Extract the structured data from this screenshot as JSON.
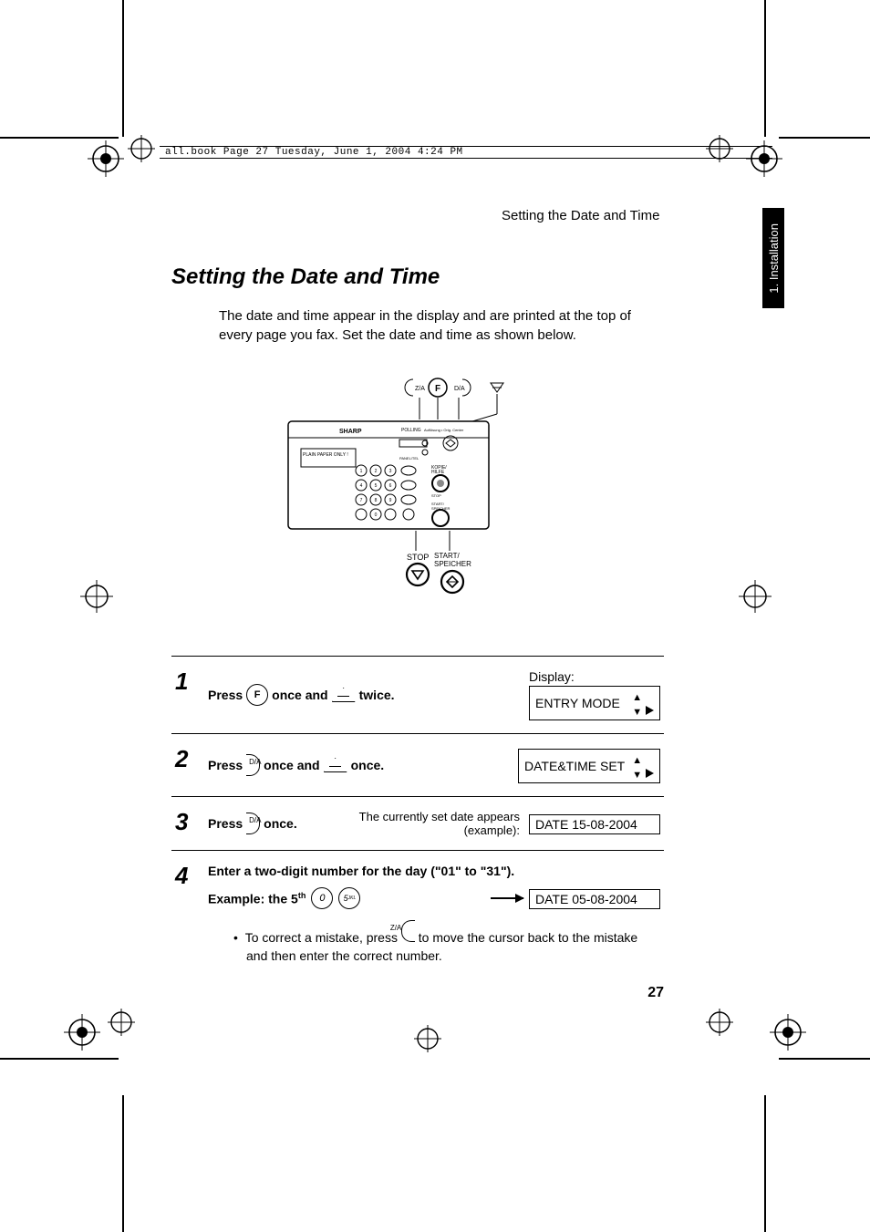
{
  "header_strip": "all.book  Page 27  Tuesday, June 1, 2004  4:24 PM",
  "running_head": "Setting the Date and Time",
  "side_tab": "1. Installation",
  "title": "Setting the Date and Time",
  "intro": "The date and time appear in the display and are printed at the top of every page you fax. Set the date and time as shown below.",
  "fax_labels": {
    "top_keys": [
      "Z/A",
      "F",
      "D/A"
    ],
    "brand": "SHARP",
    "below": [
      "STOP",
      "START/\nSPEICHER",
      "KOPIE/HILFE"
    ]
  },
  "display_label": "Display:",
  "steps": [
    {
      "n": "1",
      "parts": [
        "Press ",
        {
          "key": "oval",
          "t": "F"
        },
        " once and ",
        {
          "key": "tri"
        },
        " twice."
      ],
      "lcd": "ENTRY MODE",
      "lcd_arrows": true
    },
    {
      "n": "2",
      "parts": [
        "Press ",
        {
          "key": "half",
          "t": "D/A"
        },
        " once and ",
        {
          "key": "tri"
        },
        " once."
      ],
      "lcd": "DATE&TIME SET",
      "lcd_arrows": true
    },
    {
      "n": "3",
      "parts": [
        "Press ",
        {
          "key": "half",
          "t": "D/A"
        },
        " once."
      ],
      "aside": "The currently set date appears (example):",
      "lcd": "DATE 15-08-2004"
    },
    {
      "n": "4",
      "line1": "Enter a two-digit number for the day (\"01\" to \"31\").",
      "example_prefix": "Example: the 5",
      "example_suffix": "th",
      "example_keys": [
        "0",
        "5 JKL"
      ],
      "lcd": "DATE 05-08-2004",
      "note_pre": "To correct a mistake, press ",
      "note_key": "Z/A",
      "note_post": " to move the cursor back to the mistake and then enter the correct number."
    }
  ],
  "page_number": "27"
}
